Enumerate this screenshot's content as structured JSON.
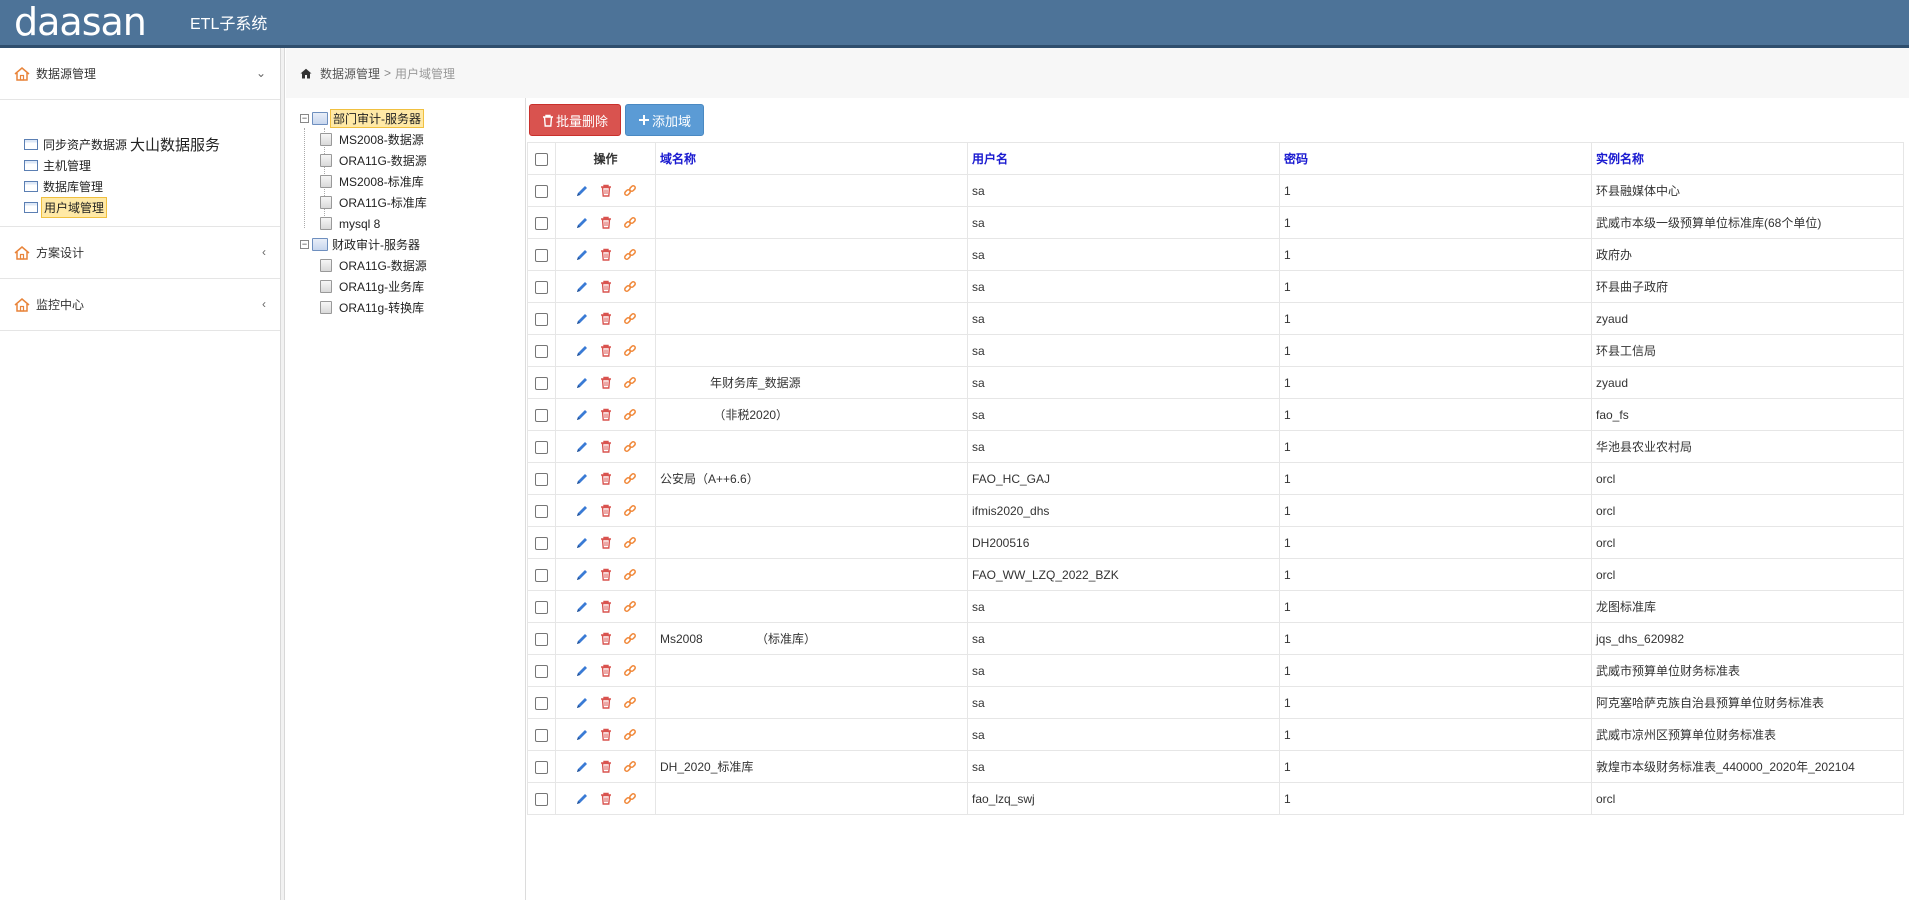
{
  "header": {
    "logo": "daasan",
    "system_title": "ETL子系统"
  },
  "sidebar": {
    "brand_name": "大山数据服务",
    "groups": [
      {
        "label": "数据源管理",
        "arrow": "⌄"
      },
      {
        "label": "方案设计",
        "arrow": "‹"
      },
      {
        "label": "监控中心",
        "arrow": "‹"
      }
    ],
    "items": [
      {
        "label": "同步资产数据源"
      },
      {
        "label": "主机管理"
      },
      {
        "label": "数据库管理"
      },
      {
        "label": "用户域管理"
      }
    ]
  },
  "breadcrumb": {
    "home": "数据源管理",
    "sep": ">",
    "current": "用户域管理"
  },
  "tree": {
    "roots": [
      {
        "label": "部门审计-服务器",
        "children": [
          "MS2008-数据源",
          "ORA11G-数据源",
          "MS2008-标准库",
          "ORA11G-标准库",
          "mysql 8"
        ]
      },
      {
        "label": "财政审计-服务器",
        "children": [
          "ORA11G-数据源",
          "ORA11g-业务库",
          "ORA11g-转换库"
        ]
      }
    ]
  },
  "toolbar": {
    "batch_delete": "批量删除",
    "add_domain": "添加域"
  },
  "table": {
    "headers": {
      "op": "操作",
      "domain": "域名称",
      "user": "用户名",
      "password": "密码",
      "instance": "实例名称"
    },
    "rows": [
      {
        "domain": "",
        "user": "sa",
        "password": "1",
        "instance": "环县融媒体中心"
      },
      {
        "domain": "",
        "user": "sa",
        "password": "1",
        "instance": "武威市本级一级预算单位标准库(68个单位)"
      },
      {
        "domain": "",
        "user": "sa",
        "password": "1",
        "instance": "政府办"
      },
      {
        "domain": "",
        "user": "sa",
        "password": "1",
        "instance": "环县曲子政府"
      },
      {
        "domain": "",
        "user": "sa",
        "password": "1",
        "instance": "zyaud"
      },
      {
        "domain": "",
        "user": "sa",
        "password": "1",
        "instance": "环县工信局"
      },
      {
        "domain": "               年财务库_数据源",
        "user": "sa",
        "password": "1",
        "instance": "zyaud"
      },
      {
        "domain": "                （非税2020）",
        "user": "sa",
        "password": "1",
        "instance": "fao_fs"
      },
      {
        "domain": "",
        "user": "sa",
        "password": "1",
        "instance": "华池县农业农村局"
      },
      {
        "domain": "公安局（A++6.6）",
        "user": "FAO_HC_GAJ",
        "password": "1",
        "instance": "orcl"
      },
      {
        "domain": "",
        "user": "ifmis2020_dhs",
        "password": "1",
        "instance": "orcl"
      },
      {
        "domain": "",
        "user": "DH200516",
        "password": "1",
        "instance": "orcl"
      },
      {
        "domain": "",
        "user": "FAO_WW_LZQ_2022_BZK",
        "password": "1",
        "instance": "orcl"
      },
      {
        "domain": "",
        "user": "sa",
        "password": "1",
        "instance": "龙图标准库"
      },
      {
        "domain": "Ms2008                （标准库）",
        "user": "sa",
        "password": "1",
        "instance": "jqs_dhs_620982"
      },
      {
        "domain": "",
        "user": "sa",
        "password": "1",
        "instance": "武威市预算单位财务标准表"
      },
      {
        "domain": "",
        "user": "sa",
        "password": "1",
        "instance": "阿克塞哈萨克族自治县预算单位财务标准表"
      },
      {
        "domain": "",
        "user": "sa",
        "password": "1",
        "instance": "武威市凉州区预算单位财务标准表"
      },
      {
        "domain": "DH_2020_标准库",
        "user": "sa",
        "password": "1",
        "instance": "敦煌市本级财务标准表_440000_2020年_202104"
      },
      {
        "domain": "",
        "user": "fao_lzq_swj",
        "password": "1",
        "instance": "orcl"
      }
    ]
  },
  "colors": {
    "header_bg": "#4d7398",
    "header_text": "#ffffff",
    "red_button": "#d9534f",
    "blue_button": "#5b9bd5",
    "column_header": "#1a1ad0",
    "edit_icon": "#3a7bd5",
    "delete_icon": "#d9534f",
    "link_icon": "#f0883a",
    "home_icon": "#e8843a"
  }
}
